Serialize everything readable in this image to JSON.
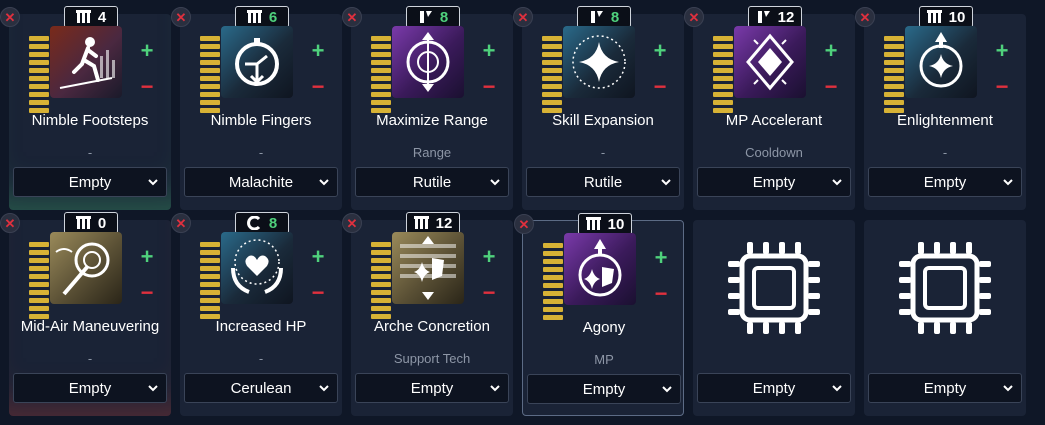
{
  "slots": [
    {
      "name": "Nimble Footsteps",
      "sub": "-",
      "module": "Empty",
      "rank_type": "bars",
      "rank_value": "4",
      "rank_color": "white",
      "icon": "running-figure-icon",
      "glow": "green",
      "selected": false,
      "empty": false
    },
    {
      "name": "Nimble Fingers",
      "sub": "-",
      "module": "Malachite",
      "rank_type": "bars",
      "rank_value": "6",
      "rank_color": "green",
      "icon": "stopwatch-icon",
      "glow": "",
      "selected": false,
      "empty": false
    },
    {
      "name": "Maximize Range",
      "sub": "Range",
      "module": "Rutile",
      "rank_type": "slash",
      "rank_value": "8",
      "rank_color": "green",
      "icon": "range-target-icon",
      "glow": "",
      "selected": false,
      "empty": false
    },
    {
      "name": "Skill Expansion",
      "sub": "-",
      "module": "Rutile",
      "rank_type": "slash",
      "rank_value": "8",
      "rank_color": "green",
      "icon": "sparkle-star-icon",
      "glow": "",
      "selected": false,
      "empty": false
    },
    {
      "name": "MP Accelerant",
      "sub": "Cooldown",
      "module": "Empty",
      "rank_type": "slash",
      "rank_value": "12",
      "rank_color": "white",
      "icon": "diamond-crystal-icon",
      "glow": "",
      "selected": false,
      "empty": false
    },
    {
      "name": "Enlightenment",
      "sub": "-",
      "module": "Empty",
      "rank_type": "bars",
      "rank_value": "10",
      "rank_color": "white",
      "icon": "star-arrow-icon",
      "glow": "",
      "selected": false,
      "empty": false
    },
    {
      "name": "Mid-Air Maneuvering",
      "sub": "-",
      "module": "Empty",
      "rank_type": "bars",
      "rank_value": "0",
      "rank_color": "white",
      "icon": "grapple-hook-icon",
      "glow": "red",
      "selected": false,
      "empty": false
    },
    {
      "name": "Increased HP",
      "sub": "-",
      "module": "Cerulean",
      "rank_type": "c",
      "rank_value": "8",
      "rank_color": "green",
      "icon": "heart-hands-icon",
      "glow": "",
      "selected": false,
      "empty": false
    },
    {
      "name": "Arche Concretion",
      "sub": "Support Tech",
      "module": "Empty",
      "rank_type": "bars",
      "rank_value": "12",
      "rank_color": "white",
      "icon": "shield-star-icon",
      "glow": "",
      "selected": false,
      "empty": false
    },
    {
      "name": "Agony",
      "sub": "MP",
      "module": "Empty",
      "rank_type": "bars",
      "rank_value": "10",
      "rank_color": "white",
      "icon": "shield-arrow-icon",
      "glow": "",
      "selected": true,
      "empty": false
    },
    {
      "name": "",
      "sub": "",
      "module": "Empty",
      "empty": true,
      "icon": "chip-icon"
    },
    {
      "name": "",
      "sub": "",
      "module": "Empty",
      "empty": true,
      "icon": "chip-icon"
    }
  ],
  "colors": {
    "plus": "#4fd17c",
    "minus": "#e0303e",
    "level_bar": "#d7b235",
    "rank_green": "#4fd17c"
  },
  "controls": {
    "plus_label": "+",
    "minus_label": "−",
    "remove_label": "✕"
  }
}
